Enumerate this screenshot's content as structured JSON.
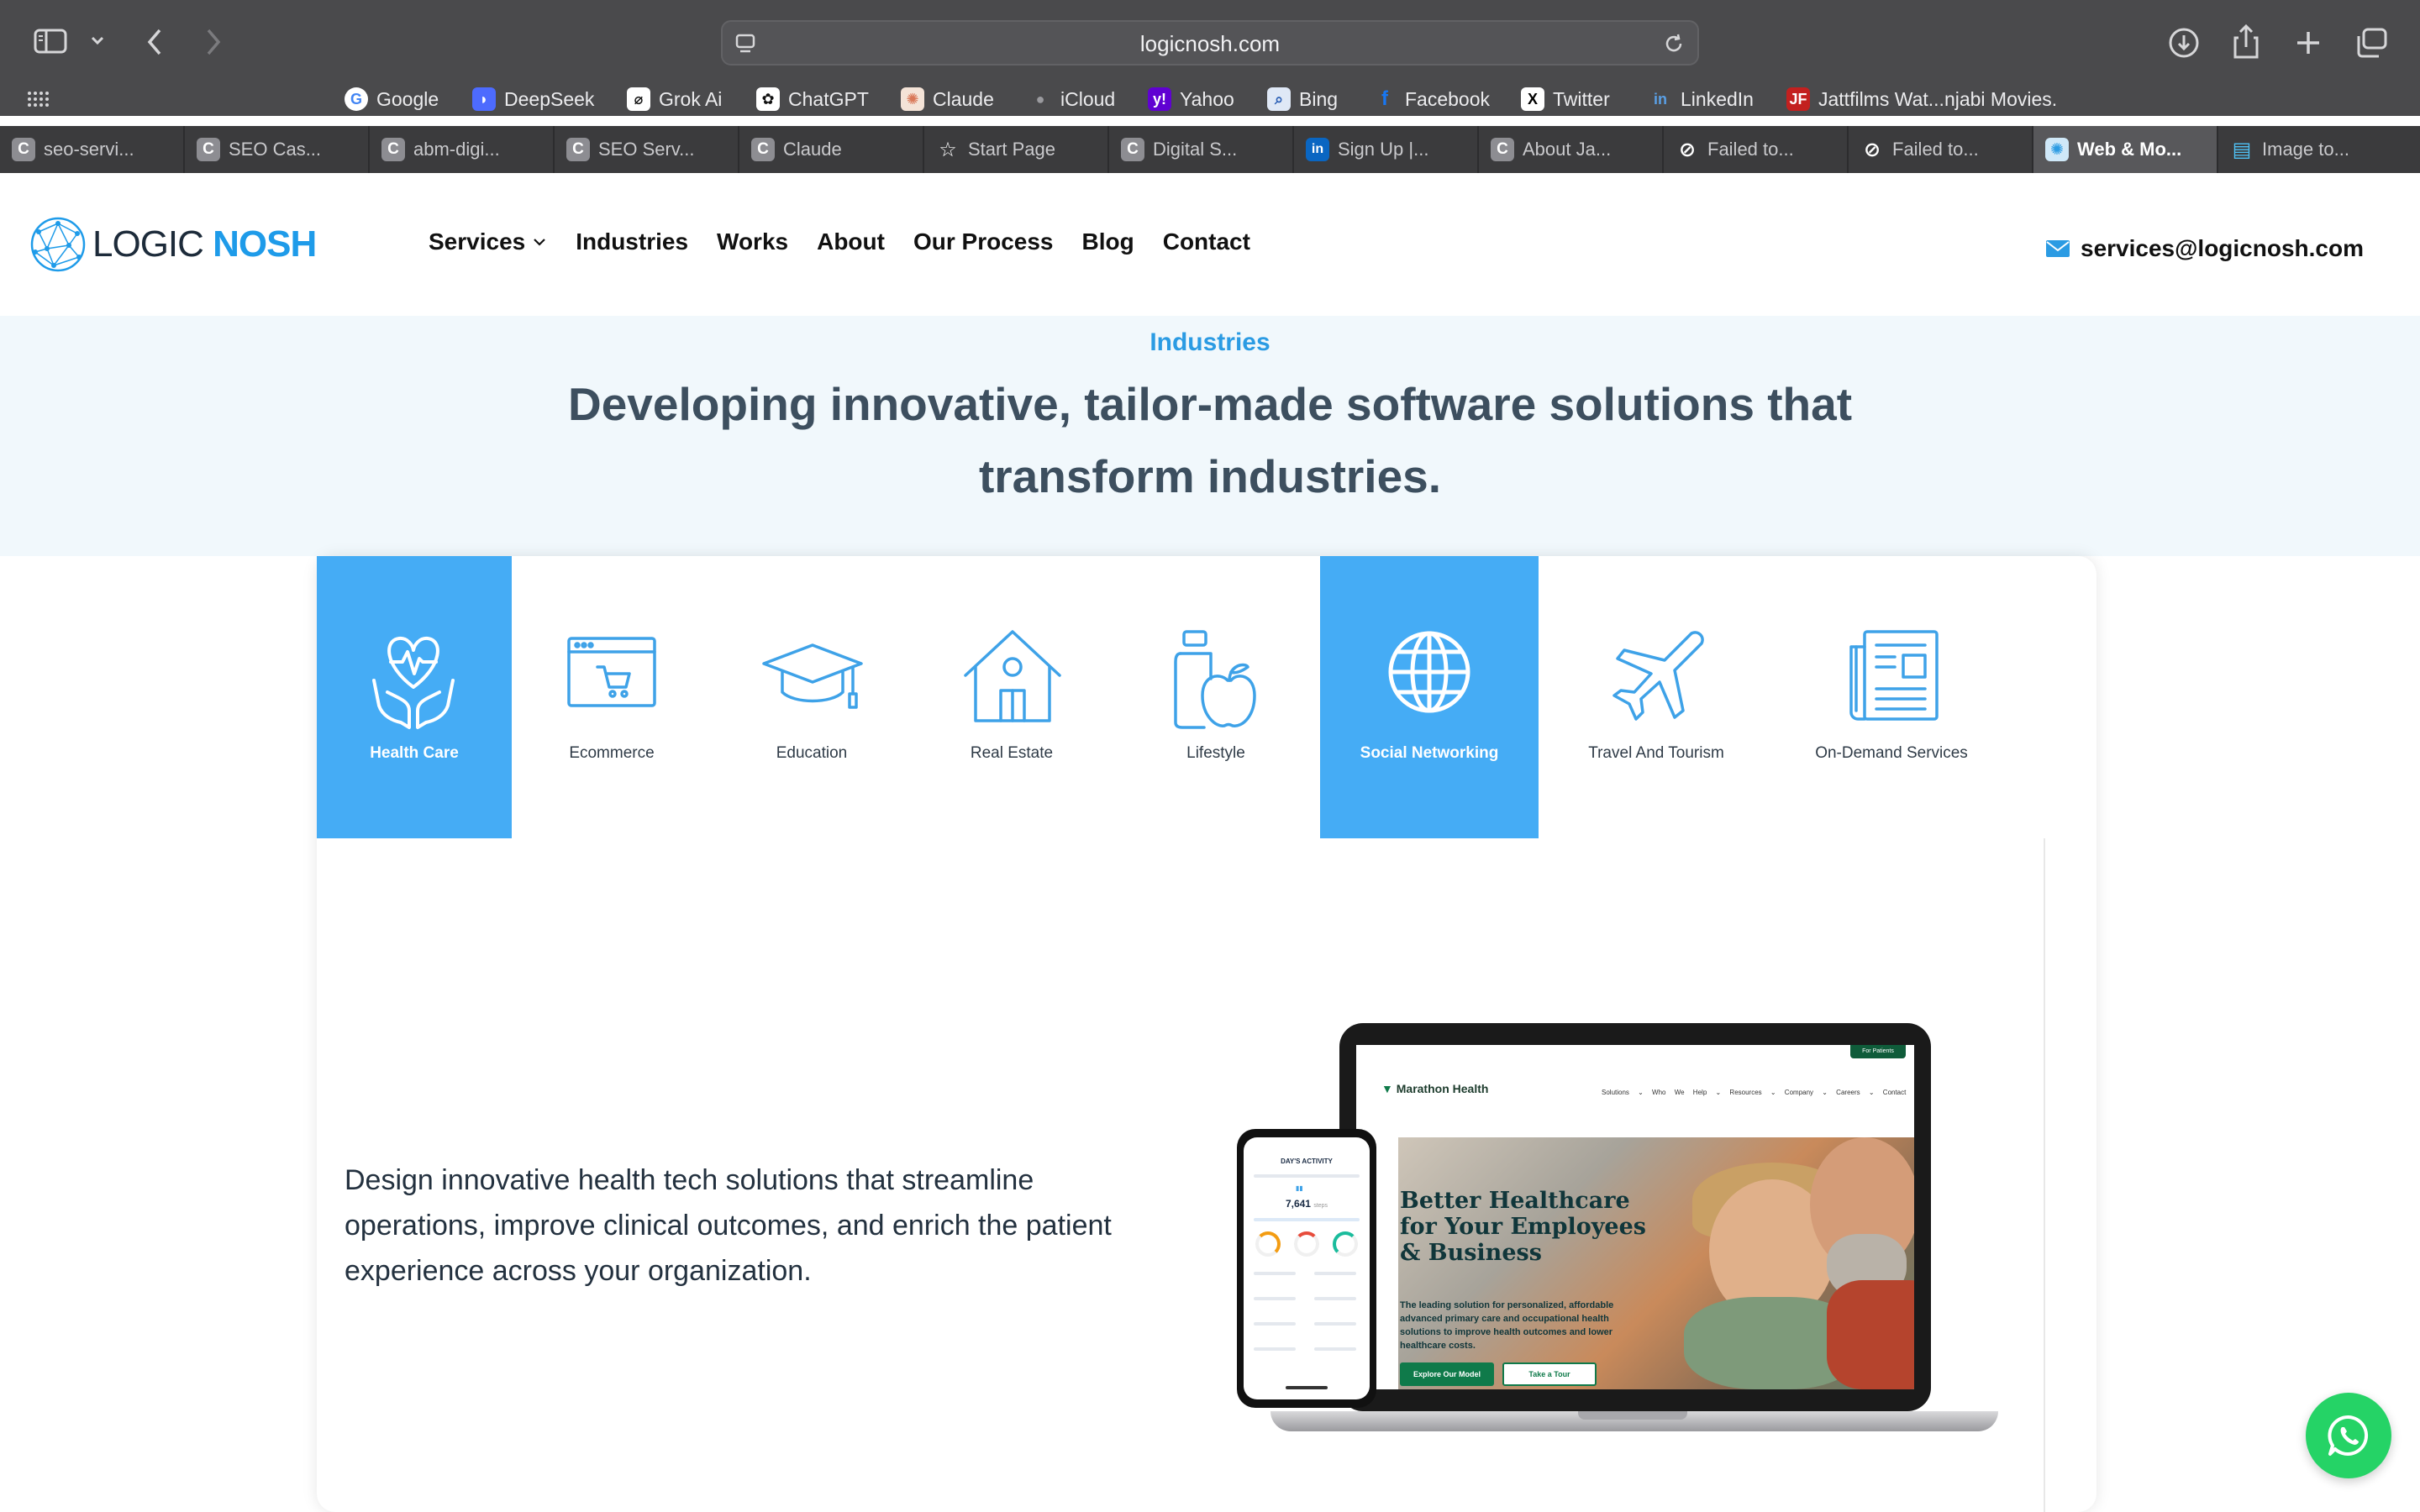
{
  "browser": {
    "url": "logicnosh.com",
    "favorites": [
      {
        "label": "Google",
        "icon": "google-icon",
        "color": "#ffffff"
      },
      {
        "label": "DeepSeek",
        "icon": "deepseek-icon",
        "color": "#4d6bfe"
      },
      {
        "label": "Grok Ai",
        "icon": "grok-icon",
        "color": "#222222"
      },
      {
        "label": "ChatGPT",
        "icon": "chatgpt-icon",
        "color": "#222222"
      },
      {
        "label": "Claude",
        "icon": "claude-icon",
        "color": "#d97757"
      },
      {
        "label": "iCloud",
        "icon": "apple-icon",
        "color": "#4a4a4c"
      },
      {
        "label": "Yahoo",
        "icon": "yahoo-icon",
        "color": "#6001d2"
      },
      {
        "label": "Bing",
        "icon": "bing-icon",
        "color": "#5d8fd6"
      },
      {
        "label": "Facebook",
        "icon": "facebook-icon",
        "color": "#1877f2"
      },
      {
        "label": "Twitter",
        "icon": "x-icon",
        "color": "#000000"
      },
      {
        "label": "LinkedIn",
        "icon": "linkedin-icon",
        "color": "#0a66c2"
      },
      {
        "label": "Jattfilms Wat...njabi Movies.",
        "icon": "jattfilms-icon",
        "color": "#c3201f"
      }
    ],
    "tabs": [
      {
        "label": "seo-servi...",
        "icon": "C"
      },
      {
        "label": "SEO Cas...",
        "icon": "C"
      },
      {
        "label": "abm-digi...",
        "icon": "C"
      },
      {
        "label": "SEO Serv...",
        "icon": "C"
      },
      {
        "label": "Claude",
        "icon": "C"
      },
      {
        "label": "Start Page",
        "icon": "☆"
      },
      {
        "label": "Digital S...",
        "icon": "C"
      },
      {
        "label": "Sign Up |...",
        "icon": "in"
      },
      {
        "label": "About Ja...",
        "icon": "C"
      },
      {
        "label": "Failed to...",
        "icon": "⊘"
      },
      {
        "label": "Failed to...",
        "icon": "⊘"
      },
      {
        "label": "Web & Mo...",
        "icon": "✺",
        "active": true
      },
      {
        "label": "Image to...",
        "icon": "▤"
      }
    ]
  },
  "site": {
    "logo_left": "LOGIC ",
    "logo_right": "NOSH",
    "nav": [
      "Services",
      "Industries",
      "Works",
      "About",
      "Our Process",
      "Blog",
      "Contact"
    ],
    "email": "services@logicnosh.com",
    "accent": "#45acf5"
  },
  "hero": {
    "kicker": "Industries",
    "headline": "Developing innovative, tailor-made software solutions that transform industries."
  },
  "industries": [
    {
      "label": "Health Care",
      "icon": "heart-hands-icon",
      "active": true
    },
    {
      "label": "Ecommerce",
      "icon": "shopping-cart-icon",
      "active": false
    },
    {
      "label": "Education",
      "icon": "graduation-cap-icon",
      "active": false
    },
    {
      "label": "Real Estate",
      "icon": "house-icon",
      "active": false
    },
    {
      "label": "Lifestyle",
      "icon": "apple-bottle-icon",
      "active": false
    },
    {
      "label": "Social Networking",
      "icon": "globe-icon",
      "active": true
    },
    {
      "label": "Travel And Tourism",
      "icon": "airplane-icon",
      "active": false
    },
    {
      "label": "On-Demand Services",
      "icon": "newspaper-icon",
      "active": false
    }
  ],
  "content": {
    "description": "Design innovative health tech solutions that streamline operations, improve clinical outcomes, and enrich the patient experience across your organization."
  },
  "mockup": {
    "brand": "Marathon Health",
    "menu": "Solutions ⌄  Who We Help ⌄  Resources ⌄  Company ⌄  Careers ⌄  Contact Us",
    "badge": "For Patients",
    "title": "Better Healthcare for Your Employees & Business",
    "subtitle": "The leading solution for personalized, affordable advanced primary care and occupational health solutions to improve health outcomes and lower healthcare costs.",
    "button1": "Explore Our Model",
    "button2": "Take a Tour",
    "phone_title": "DAY'S ACTIVITY",
    "phone_steps": "7,641",
    "phone_steps_unit": "steps"
  },
  "whatsapp": {
    "icon": "whatsapp-icon",
    "color": "#25d366"
  }
}
